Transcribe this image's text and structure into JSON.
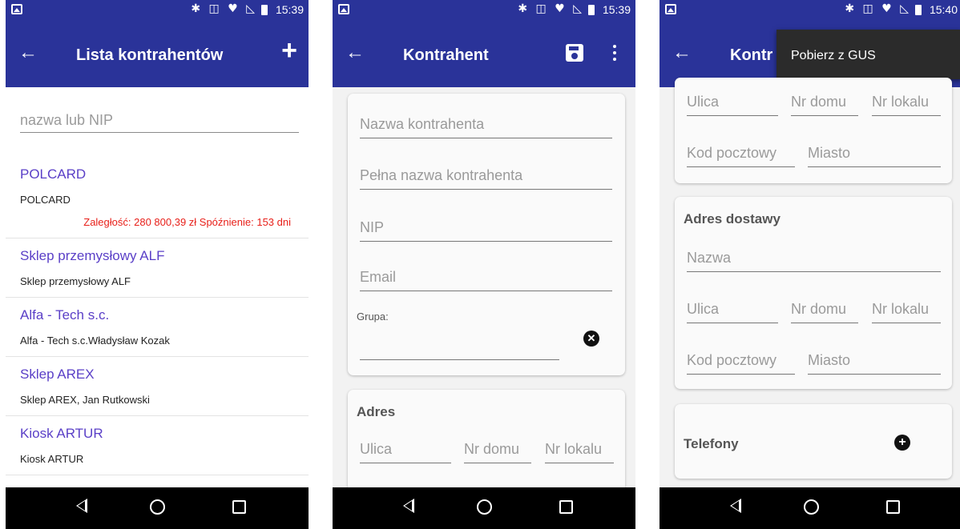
{
  "status": {
    "screen1_time": "15:39",
    "screen2_time": "15:39",
    "screen3_time": "15:40"
  },
  "screen1": {
    "title": "Lista kontrahentów",
    "search_placeholder": "nazwa lub NIP",
    "items": [
      {
        "name": "POLCARD",
        "sub": "POLCARD",
        "alert": "Zaległość: 280 800,39 zł Spóźnienie: 153 dni"
      },
      {
        "name": "Sklep przemysłowy ALF",
        "sub": "Sklep przemysłowy ALF"
      },
      {
        "name": "Alfa - Tech s.c.",
        "sub": "Alfa - Tech s.c.Władysław Kozak"
      },
      {
        "name": "Sklep AREX",
        "sub": "Sklep AREX, Jan Rutkowski"
      },
      {
        "name": "Kiosk ARTUR",
        "sub": "Kiosk ARTUR"
      }
    ]
  },
  "screen2": {
    "title": "Kontrahent",
    "fields": {
      "nazwa": "Nazwa kontrahenta",
      "pelna": "Pełna nazwa kontrahenta",
      "nip": "NIP",
      "email": "Email",
      "grupa_label": "Grupa:"
    },
    "adres": {
      "heading": "Adres",
      "ulica": "Ulica",
      "nr_domu": "Nr domu",
      "nr_lokalu": "Nr lokalu"
    }
  },
  "screen3": {
    "title": "Kontr",
    "menu_item": "Pobierz z GUS",
    "adres": {
      "ulica": "Ulica",
      "nr_domu": "Nr domu",
      "nr_lokalu": "Nr lokalu",
      "kod": "Kod pocztowy",
      "miasto": "Miasto"
    },
    "dostawa": {
      "heading": "Adres dostawy",
      "nazwa": "Nazwa",
      "ulica": "Ulica",
      "nr_domu": "Nr domu",
      "nr_lokalu": "Nr lokalu",
      "kod": "Kod pocztowy",
      "miasto": "Miasto"
    },
    "telefony": "Telefony"
  },
  "icons": [
    "back-arrow-icon",
    "add-icon",
    "save-icon",
    "more-vert-icon",
    "clear-icon",
    "add-circle-icon",
    "nav-back-icon",
    "nav-home-icon",
    "nav-recent-icon"
  ],
  "colors": {
    "primary": "#2a3399",
    "accent_text": "#5a3fc7",
    "alert": "#e8201a"
  }
}
